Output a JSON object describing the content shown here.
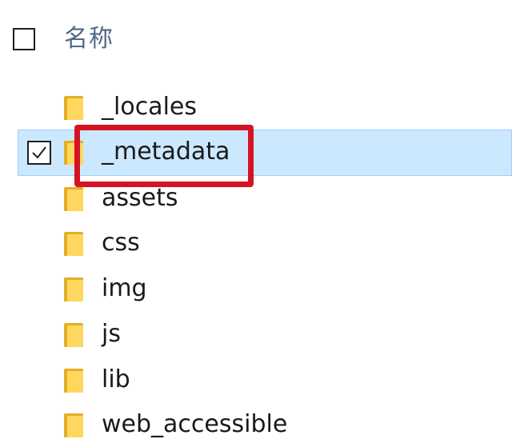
{
  "header": {
    "name_column_label": "名称"
  },
  "files": [
    {
      "name": "_locales",
      "selected": false
    },
    {
      "name": "_metadata",
      "selected": true
    },
    {
      "name": "assets",
      "selected": false
    },
    {
      "name": "css",
      "selected": false
    },
    {
      "name": "img",
      "selected": false
    },
    {
      "name": "js",
      "selected": false
    },
    {
      "name": "lib",
      "selected": false
    },
    {
      "name": "web_accessible",
      "selected": false
    }
  ],
  "colors": {
    "selection_background": "#cce8ff",
    "selection_border": "#99d1ff",
    "highlight_box": "#d41323",
    "folder_back": "#e3ad26",
    "folder_front": "#ffd75e"
  },
  "icons": {
    "folder": "folder-icon",
    "checkbox_checked": "checkmark-icon"
  }
}
